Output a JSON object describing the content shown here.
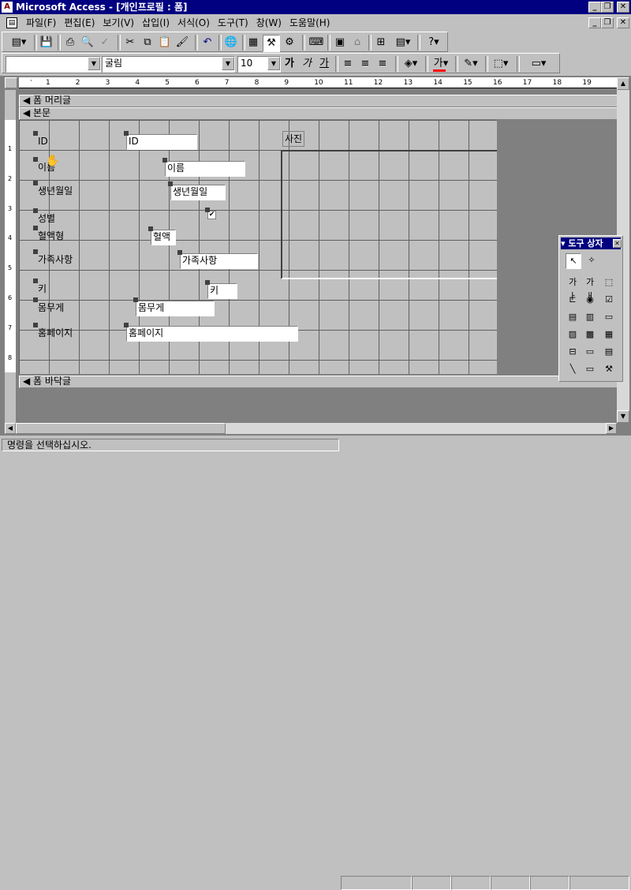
{
  "window": {
    "title": "Microsoft Access - [개인프로필 : 폼]"
  },
  "menu": [
    "파일(F)",
    "편집(E)",
    "보기(V)",
    "삽입(I)",
    "서식(O)",
    "도구(T)",
    "창(W)",
    "도움말(H)"
  ],
  "format_toolbar": {
    "object_combo": "",
    "font_combo": "굴림",
    "size_combo": "10",
    "bold": "가",
    "italic": "가",
    "underline": "가",
    "fore_color_letter": "가"
  },
  "ruler": {
    "numbers": [
      "1",
      "2",
      "3",
      "4",
      "5",
      "6",
      "7",
      "8",
      "9",
      "10",
      "11",
      "12",
      "13",
      "14",
      "15",
      "16",
      "17",
      "18",
      "19"
    ]
  },
  "vruler": [
    "1",
    "2",
    "3",
    "4",
    "5",
    "6",
    "7",
    "8"
  ],
  "sections": {
    "header": "폼 머리글",
    "detail": "본문",
    "footer": "폼 바닥글"
  },
  "labels": [
    "ID",
    "이름",
    "생년월일",
    "성별",
    "혈액형",
    "가족사항",
    "키",
    "몸무게",
    "홈페이지"
  ],
  "textboxes": [
    "ID",
    "이름",
    "생년월일",
    "혈액",
    "가족사항",
    "키",
    "몸무게",
    "홈페이지"
  ],
  "photo_label": "사진",
  "toolbox": {
    "title": "도구 상자",
    "label_tool": "가ㅏ",
    "textbox_tool": "가ㅐ"
  },
  "status": {
    "text": "명령을 선택하십시오."
  },
  "colors": {
    "title_bg": "#000080",
    "workspace": "#808080",
    "grid": "#c0c0c0",
    "fore_color_bar": "#ff0000"
  }
}
